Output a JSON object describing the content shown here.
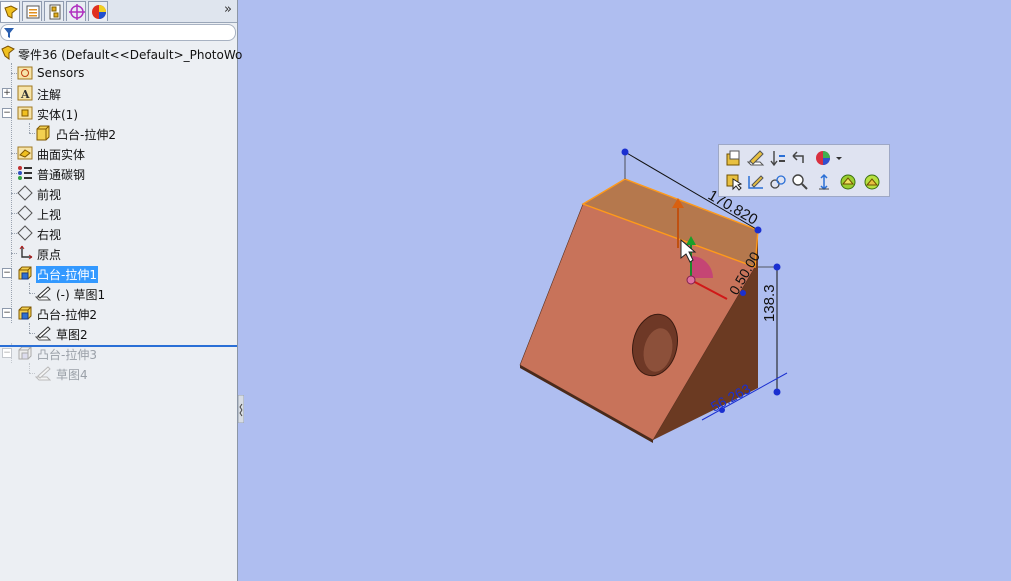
{
  "tabs": [
    {
      "name": "featuremanager-tab"
    },
    {
      "name": "propertymanager-tab"
    },
    {
      "name": "configurationmanager-tab"
    },
    {
      "name": "dimxpert-tab"
    },
    {
      "name": "appearance-tab"
    }
  ],
  "more_tabs": "»",
  "tree": {
    "part_title": "零件36  (Default<<Default>_PhotoWo",
    "items": [
      {
        "label": "Sensors"
      },
      {
        "label": "注解"
      },
      {
        "label": "实体(1)"
      },
      {
        "label": "凸台-拉伸2"
      },
      {
        "label": "曲面实体"
      },
      {
        "label": "普通碳钢"
      },
      {
        "label": "前视"
      },
      {
        "label": "上视"
      },
      {
        "label": "右视"
      },
      {
        "label": "原点"
      },
      {
        "label": "凸台-拉伸1"
      },
      {
        "label": "(-) 草图1"
      },
      {
        "label": "凸台-拉伸2"
      },
      {
        "label": "草图2"
      },
      {
        "label": "凸台-拉伸3"
      },
      {
        "label": "草图4"
      }
    ]
  },
  "dimensions": {
    "d1": "170.820",
    "d2": "0.50.00",
    "d3": "138.3",
    "d4": "56.263"
  },
  "colors": {
    "viewport_bg": "#afbef0",
    "part_face_front": "#c8735a",
    "part_face_side": "#6b3a22",
    "part_face_top": "#b5784d",
    "highlight_edge": "#ff9a1a",
    "selection": "#3399ff"
  }
}
